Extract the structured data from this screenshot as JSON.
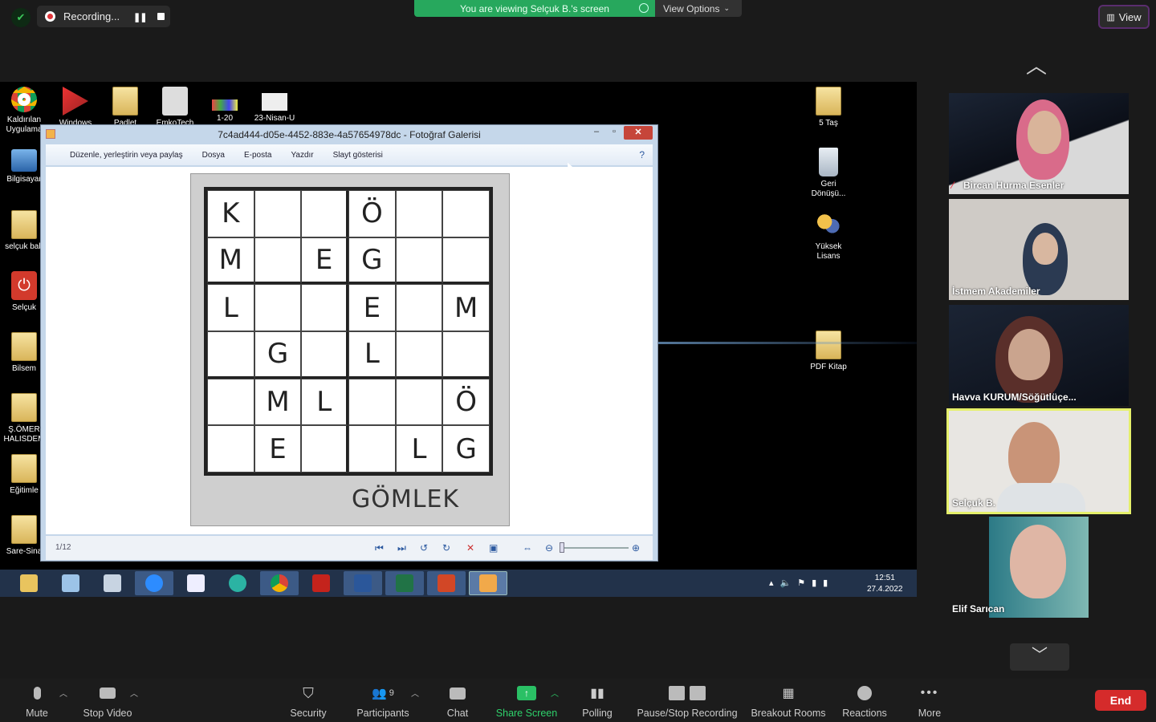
{
  "top": {
    "recording_label": "Recording...",
    "viewing_banner": "You are viewing Selçuk B.'s screen",
    "view_options": "View Options",
    "view_button": "View"
  },
  "desktop": {
    "left_icons": [
      "Kaldırılan Uygulama",
      "Bilgisayar",
      "selçuk bab",
      "Selçuk",
      "Bilsem",
      "Ş.ÖMER HALISDEM",
      "Eğitimle",
      "Sare-Sina"
    ],
    "top_icons": [
      "Windows",
      "Padlet",
      "EmkoTech",
      "1-20",
      "23-Nisan-U"
    ],
    "right_icons": [
      "5 Taş",
      "Geri Dönüşü...",
      "Yüksek Lisans",
      "PDF Kitap"
    ]
  },
  "gallery": {
    "title": "7c4ad444-d05e-4452-883e-4a57654978dc - Fotoğraf Galerisi",
    "menu": [
      "Düzenle, yerleştirin veya paylaş",
      "Dosya",
      "E-posta",
      "Yazdır",
      "Slayt gösterisi"
    ],
    "page_indicator": "1/12",
    "puzzle_rows": [
      [
        "K",
        "",
        "",
        "Ö",
        "",
        ""
      ],
      [
        "M",
        "",
        "E",
        "G",
        "",
        ""
      ],
      [
        "L",
        "",
        "",
        "E",
        "",
        "M"
      ],
      [
        "",
        "G",
        "",
        "L",
        "",
        ""
      ],
      [
        "",
        "M",
        "L",
        "",
        "",
        "Ö"
      ],
      [
        "",
        "E",
        "",
        "",
        "L",
        "G"
      ]
    ],
    "puzzle_caption": "GÖMLEK"
  },
  "taskbar": {
    "time": "12:51",
    "date": "27.4.2022"
  },
  "participants": [
    {
      "name": "Bircan Hurma Esenler"
    },
    {
      "name": "İstmem Akademiler"
    },
    {
      "name": "Havva KURUM/Söğütlüçe..."
    },
    {
      "name": "Selçuk B."
    },
    {
      "name": "Elif Sarıcan"
    }
  ],
  "toolbar": {
    "mute": "Mute",
    "stop_video": "Stop Video",
    "security": "Security",
    "participants": "Participants",
    "participants_count": "9",
    "chat": "Chat",
    "share_screen": "Share Screen",
    "polling": "Polling",
    "pause_stop_recording": "Pause/Stop Recording",
    "breakout_rooms": "Breakout Rooms",
    "reactions": "Reactions",
    "more": "More",
    "end": "End"
  },
  "colors": {
    "share_green": "#27a85d",
    "end_red": "#d52b2b",
    "active_speaker": "#e5f06b"
  }
}
